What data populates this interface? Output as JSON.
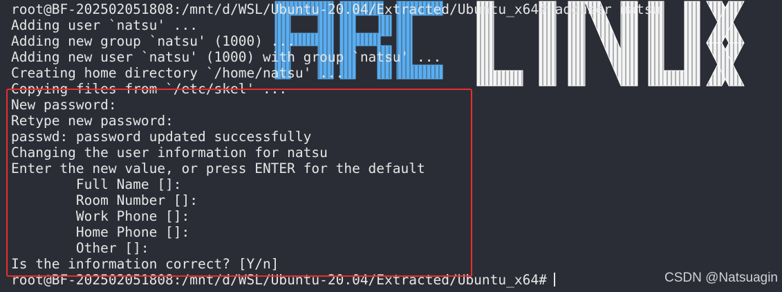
{
  "terminal": {
    "lines": [
      "root@BF-202502051808:/mnt/d/WSL/Ubuntu-20.04/Extracted/Ubuntu_x64# adduser natsu",
      "Adding user `natsu' ...",
      "Adding new group `natsu' (1000) ...",
      "Adding new user `natsu' (1000) with group `natsu' ...",
      "Creating home directory `/home/natsu' ...",
      "Copying files from `/etc/skel' ...",
      "New password:",
      "Retype new password:",
      "passwd: password updated successfully",
      "Changing the user information for natsu",
      "Enter the new value, or press ENTER for the default",
      "        Full Name []:",
      "        Room Number []:",
      "        Work Phone []:",
      "        Home Phone []:",
      "        Other []:",
      "Is the information correct? [Y/n]"
    ],
    "prompt": "root@BF-202502051808:/mnt/d/WSL/Ubuntu-20.04/Extracted/Ubuntu_x64#"
  },
  "logo": {
    "text": "ARCH LINUX",
    "colors": {
      "arch": "#5aaef0",
      "linux": "#ffffff"
    }
  },
  "highlight": {
    "color": "#e8302a"
  },
  "watermark": {
    "text": "CSDN @Natsuagin"
  }
}
